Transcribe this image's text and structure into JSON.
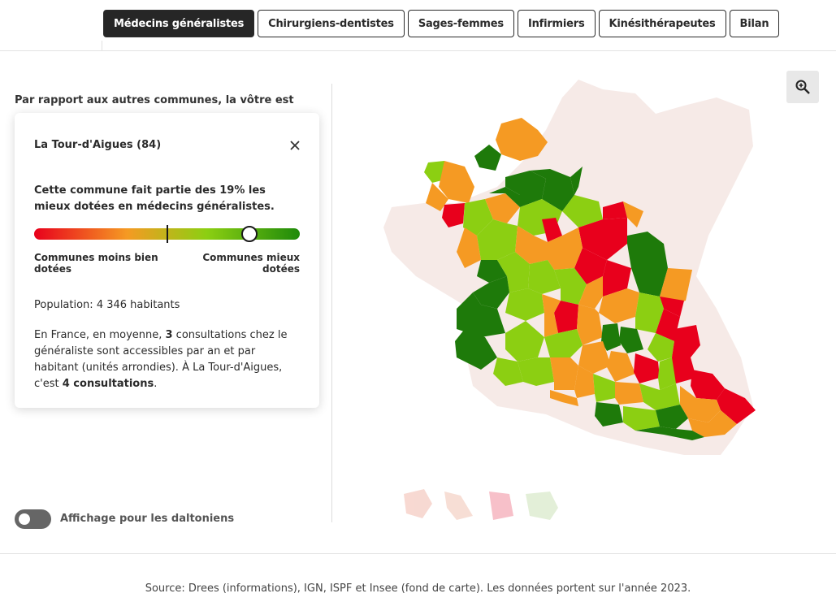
{
  "tabs": [
    {
      "label": "Médecins généralistes",
      "active": true
    },
    {
      "label": "Chirurgiens-dentistes",
      "active": false
    },
    {
      "label": "Sages-femmes",
      "active": false
    },
    {
      "label": "Infirmiers",
      "active": false
    },
    {
      "label": "Kinésithérapeutes",
      "active": false
    },
    {
      "label": "Bilan",
      "active": false
    }
  ],
  "intro": "Par rapport aux autres communes, la vôtre est",
  "card": {
    "title": "La Tour-d'Aigues (84)",
    "rank_text": "Cette commune fait partie des 19% les mieux dotées en médecins généralistes.",
    "gauge": {
      "left_label": "Communes moins bien dotées",
      "right_label": "Communes mieux dotées",
      "average_position": 0.5,
      "commune_position": 0.81
    },
    "population": "Population: 4 346 habitants",
    "desc_part1": "En France, en moyenne, ",
    "desc_bold1": "3",
    "desc_part2": " consultations chez le généraliste sont accessibles par an et par habitant (unités arrondies). À La Tour-d'Aigues, c'est ",
    "desc_bold2": "4 consultations",
    "desc_part3": "."
  },
  "toggle_label": "Affichage pour les daltoniens",
  "source": "Source: Drees (informations), IGN, ISPF et Insee (fond de carte). Les données portent sur l'année 2023.",
  "colors": {
    "red": "#e8001c",
    "orange": "#f59a23",
    "light_green": "#8ccf12",
    "dark_green": "#1e7a0a"
  },
  "icons": {
    "close": "close-icon",
    "zoom": "zoom-in-icon"
  }
}
